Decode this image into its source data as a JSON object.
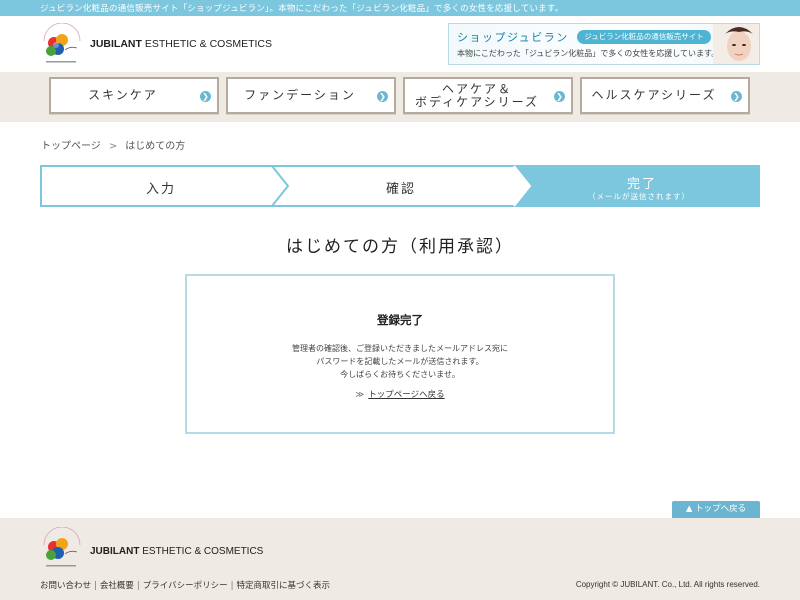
{
  "topbar": {
    "text": "ジュビラン化粧品の通信販売サイト「ショップジュビラン」。本物にこだわった「ジュビラン化粧品」で多くの女性を応援しています。"
  },
  "header": {
    "brand_bold": "JUBILANT",
    "brand_rest": " ESTHETIC & COSMETICS",
    "banner": {
      "title": "ショップジュビラン",
      "badge": "ジュビラン化粧品の通信販売サイト",
      "sub": "本物にこだわった「ジュビラン化粧品」で多くの女性を応援しています。"
    }
  },
  "nav": [
    {
      "line1": "スキンケア",
      "line2": ""
    },
    {
      "line1": "ファンデーション",
      "line2": ""
    },
    {
      "line1": "ヘアケア＆",
      "line2": "ボディケアシリーズ"
    },
    {
      "line1": "ヘルスケアシリーズ",
      "line2": ""
    }
  ],
  "breadcrumb": {
    "home": "トップページ",
    "separator": ">",
    "current": "はじめての方"
  },
  "steps": {
    "step1": "入力",
    "step2": "確認",
    "step3": "完了",
    "step3_note": "（メールが送信されます）",
    "colors": {
      "active": "#7cc7de",
      "border": "#7cc7de"
    }
  },
  "page": {
    "title": "はじめての方（利用承認）"
  },
  "complete_box": {
    "title": "登録完了",
    "line1": "管理者の確認後、ご登録いただきましたメールアドレス宛に",
    "line2": "パスワードを記載したメールが送信されます。",
    "line3": "今しばらくお待ちくださいませ。",
    "link_marker": "≫",
    "link_text": "トップページへ戻る"
  },
  "to_top": {
    "label": "トップへ戻る",
    "arrow": "🡅"
  },
  "footer": {
    "brand_bold": "JUBILANT",
    "brand_rest": " ESTHETIC & COSMETICS",
    "links": [
      "お問い合わせ",
      "会社概要",
      "プライバシーポリシー",
      "特定商取引に基づく表示"
    ],
    "separator": "|",
    "copyright": "Copyright © JUBILANT. Co., Ltd. All rights reserved."
  }
}
